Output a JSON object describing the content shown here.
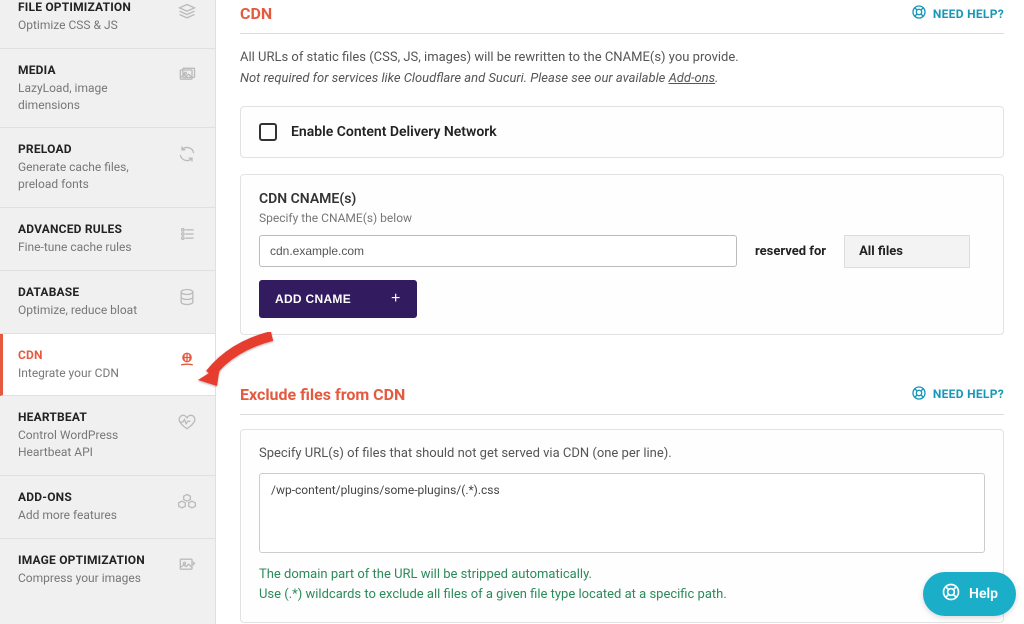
{
  "sidebar": {
    "items": [
      {
        "title": "FILE OPTIMIZATION",
        "sub": "Optimize CSS & JS"
      },
      {
        "title": "MEDIA",
        "sub": "LazyLoad, image dimensions"
      },
      {
        "title": "PRELOAD",
        "sub": "Generate cache files, preload fonts"
      },
      {
        "title": "ADVANCED RULES",
        "sub": "Fine-tune cache rules"
      },
      {
        "title": "DATABASE",
        "sub": "Optimize, reduce bloat"
      },
      {
        "title": "CDN",
        "sub": "Integrate your CDN"
      },
      {
        "title": "HEARTBEAT",
        "sub": "Control WordPress Heartbeat API"
      },
      {
        "title": "ADD-ONS",
        "sub": "Add more features"
      },
      {
        "title": "IMAGE OPTIMIZATION",
        "sub": "Compress your images"
      }
    ]
  },
  "cdn": {
    "title": "CDN",
    "need_help": "NEED HELP?",
    "desc_line1": "All URLs of static files (CSS, JS, images) will be rewritten to the CNAME(s) you provide.",
    "desc_line2_prefix": "Not required for services like Cloudflare and Sucuri. Please see our available ",
    "desc_line2_link": "Add-ons",
    "desc_line2_suffix": ".",
    "enable_label": "Enable Content Delivery Network",
    "cname_title": "CDN CNAME(s)",
    "cname_sub": "Specify the CNAME(s) below",
    "cname_value": "cdn.example.com",
    "reserved_label": "reserved for",
    "select_value": "All files",
    "add_btn": "ADD CNAME"
  },
  "exclude": {
    "title": "Exclude files from CDN",
    "need_help": "NEED HELP?",
    "desc": "Specify URL(s) of files that should not get served via CDN (one per line).",
    "textarea_value": "/wp-content/plugins/some-plugins/(.*).css",
    "hint1": "The domain part of the URL will be stripped automatically.",
    "hint2": "Use (.*) wildcards to exclude all files of a given file type located at a specific path."
  },
  "help_pill": "Help"
}
